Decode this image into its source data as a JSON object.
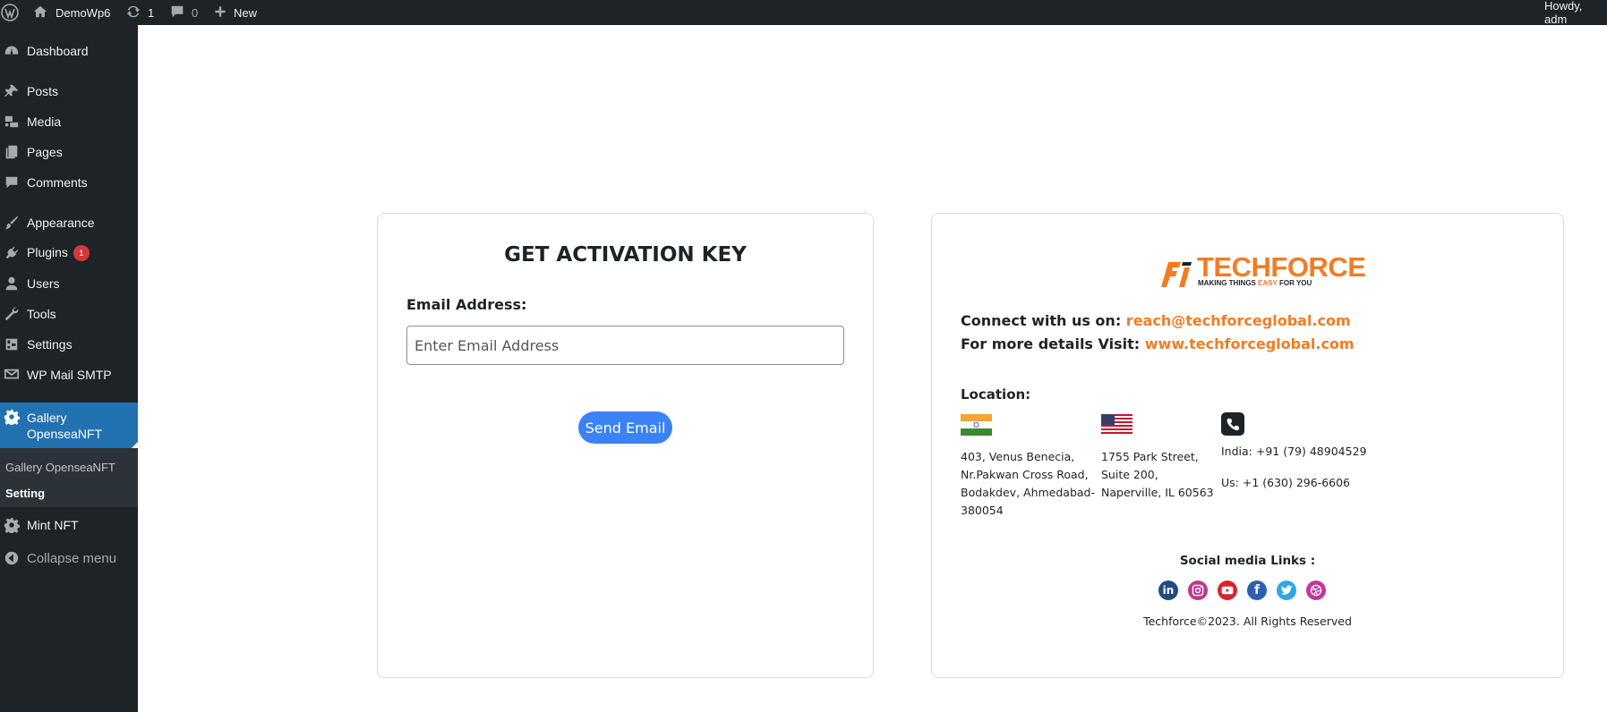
{
  "admin_bar": {
    "site_name": "DemoWp6",
    "updates_count": "1",
    "comments_count": "0",
    "new_label": "New",
    "howdy": "Howdy, adm"
  },
  "sidebar": {
    "items": {
      "dashboard": "Dashboard",
      "posts": "Posts",
      "media": "Media",
      "pages": "Pages",
      "comments": "Comments",
      "appearance": "Appearance",
      "plugins": "Plugins",
      "plugins_badge": "1",
      "users": "Users",
      "tools": "Tools",
      "settings": "Settings",
      "wp_mail_smtp": "WP Mail SMTP",
      "gallery_line1": "Gallery",
      "gallery_line2": "OpenseaNFT",
      "mint_nft": "Mint NFT",
      "collapse": "Collapse menu"
    },
    "submenu": {
      "gallery": "Gallery OpenseaNFT",
      "setting": "Setting"
    },
    "current_color": "#2271b1"
  },
  "activation_card": {
    "title": "GET ACTIVATION KEY",
    "email_label": "Email Address:",
    "email_value": "",
    "email_placeholder": "Enter Email Address",
    "send_button": "Send Email",
    "button_color": "#3b82f6"
  },
  "company_card": {
    "logo_main": "TECHFORCE",
    "logo_tag_pre": "MAKING THINGS ",
    "logo_tag_highlight": "EASY",
    "logo_tag_post": " FOR YOU",
    "connect_label": "Connect with us on:",
    "connect_email": "reach@techforceglobal.com",
    "visit_label": "For more details Visit:",
    "visit_url": "www.techforceglobal.com",
    "location_label": "Location:",
    "india_address": [
      "403, Venus Benecia,",
      "Nr.Pakwan Cross Road,",
      "Bodakdev, Ahmedabad-",
      "380054"
    ],
    "us_address": [
      "1755 Park Street,",
      "Suite 200,",
      "Naperville, IL 60563"
    ],
    "india_phone": "India: +91 (79) 48904529",
    "us_phone": "Us: +1 (630) 296-6606",
    "social_label": "Social media Links :",
    "copyright": "Techforce©2023. All Rights Reserved",
    "accent_color": "#f27c23"
  },
  "icons": [
    "wordpress-logo-icon",
    "home-icon",
    "updates-icon",
    "comment-bubble-icon",
    "plus-icon",
    "dashboard-icon",
    "pin-icon",
    "media-icon",
    "pages-icon",
    "comments-icon",
    "brush-icon",
    "plug-icon",
    "user-icon",
    "wrench-icon",
    "settings-icon",
    "mail-icon",
    "gear-icon",
    "collapse-icon",
    "india-flag-icon",
    "us-flag-icon",
    "phone-icon",
    "linkedin-icon",
    "instagram-icon",
    "youtube-icon",
    "facebook-icon",
    "twitter-icon",
    "dribbble-icon"
  ]
}
